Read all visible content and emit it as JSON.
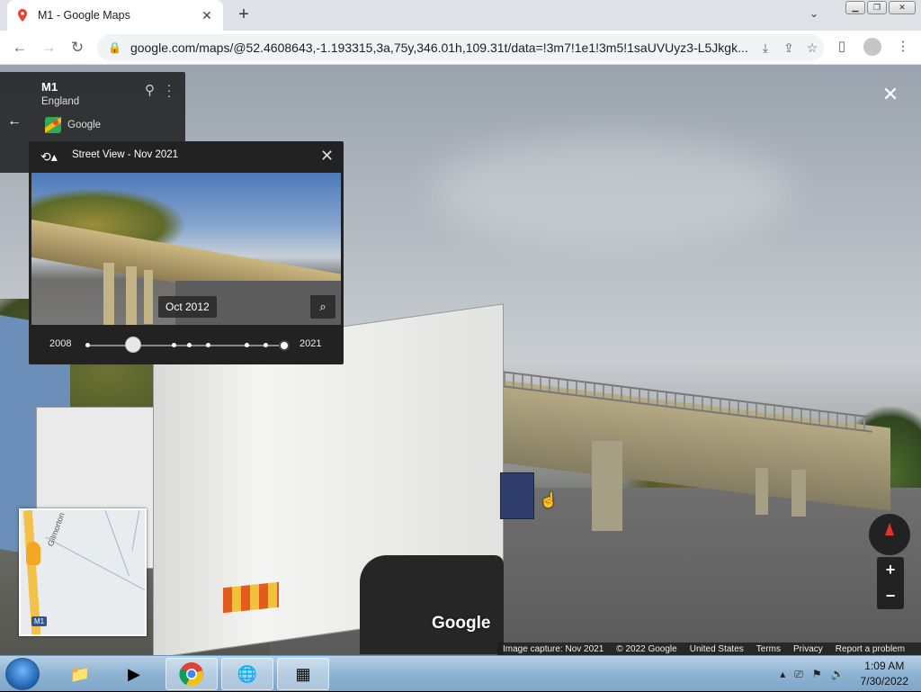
{
  "browser": {
    "tab_title": "M1 - Google Maps",
    "url": "google.com/maps/@52.4608643,-1.193315,3a,75y,346.01h,109.31t/data=!3m7!1e1!3m5!1saUVUyz3-L5Jkgk..."
  },
  "location": {
    "title": "M1",
    "subtitle": "England",
    "source": "Google"
  },
  "timemachine": {
    "title": "Street View - Nov 2021",
    "thumbnail_date": "Oct 2012",
    "year_start": "2008",
    "year_end": "2021",
    "selected_fraction": 0.23
  },
  "minimap": {
    "street_label": "Gilmorton",
    "road_shield": "M1"
  },
  "watermark": "Google",
  "footer": {
    "capture": "Image capture: Nov 2021",
    "copyright": "© 2022 Google",
    "region": "United States",
    "terms": "Terms",
    "privacy": "Privacy",
    "report": "Report a problem"
  },
  "taskbar": {
    "time": "1:09 AM",
    "date": "7/30/2022"
  },
  "colors": {
    "panel_bg": "#222222",
    "accent_red": "#e0362c",
    "maps_yellow": "#f3c04a"
  }
}
